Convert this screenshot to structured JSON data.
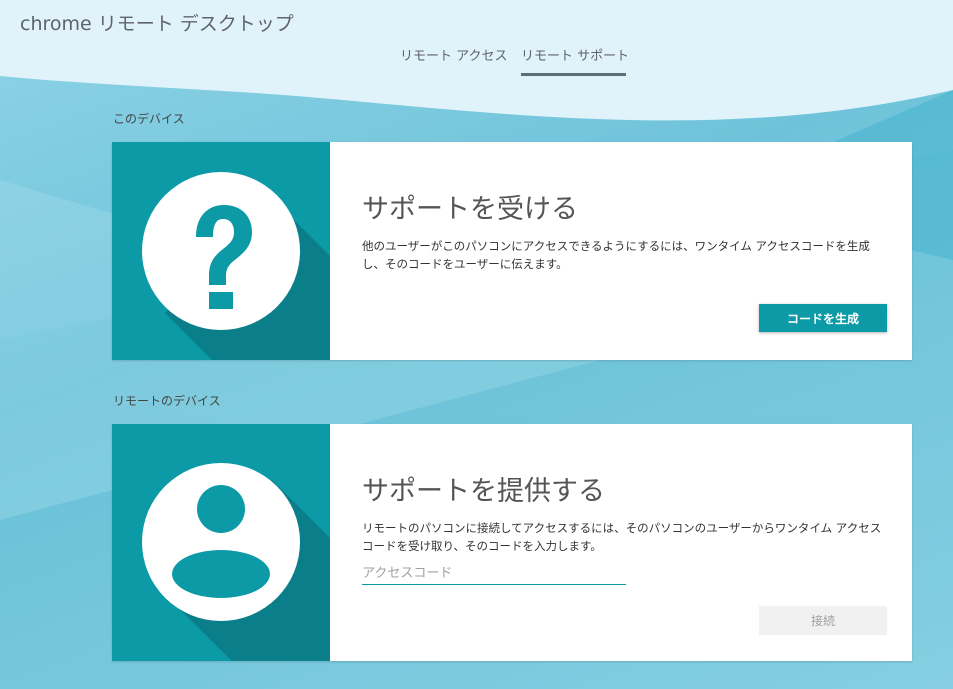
{
  "app": {
    "brand": "chrome",
    "title": "リモート デスクトップ"
  },
  "tabs": [
    {
      "label": "リモート アクセス",
      "active": false
    },
    {
      "label": "リモート サポート",
      "active": true
    }
  ],
  "sections": {
    "this_device": {
      "label": "このデバイス",
      "heading": "サポートを受ける",
      "description": "他のユーザーがこのパソコンにアクセスできるようにするには、ワンタイム アクセスコードを生成し、そのコードをユーザーに伝えます。",
      "button_label": "コードを生成",
      "icon": "help-circle-icon"
    },
    "remote_device": {
      "label": "リモートのデバイス",
      "heading": "サポートを提供する",
      "description": "リモートのパソコンに接続してアクセスするには、そのパソコンのユーザーからワンタイム アクセスコードを受け取り、そのコードを入力します。",
      "input_value": "",
      "input_placeholder": "アクセスコード",
      "button_label": "接続",
      "icon": "user-avatar-icon"
    }
  },
  "colors": {
    "accent": "#0b9aa6",
    "header_bg": "#e1f3fa",
    "page_bg": "#7cc8dc",
    "text_muted": "#5f6368"
  }
}
